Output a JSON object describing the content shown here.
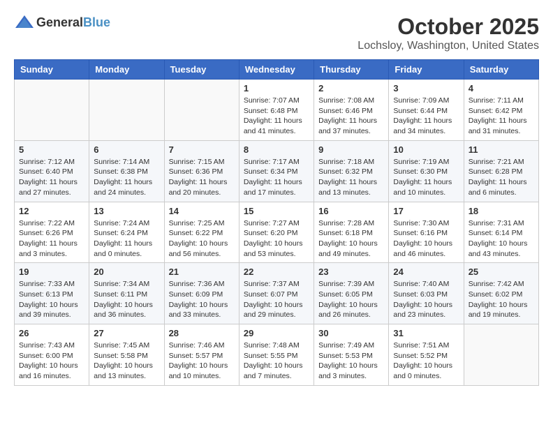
{
  "header": {
    "logo_general": "General",
    "logo_blue": "Blue",
    "month": "October 2025",
    "location": "Lochsloy, Washington, United States"
  },
  "weekdays": [
    "Sunday",
    "Monday",
    "Tuesday",
    "Wednesday",
    "Thursday",
    "Friday",
    "Saturday"
  ],
  "weeks": [
    [
      {
        "day": "",
        "sunrise": "",
        "sunset": "",
        "daylight": ""
      },
      {
        "day": "",
        "sunrise": "",
        "sunset": "",
        "daylight": ""
      },
      {
        "day": "",
        "sunrise": "",
        "sunset": "",
        "daylight": ""
      },
      {
        "day": "1",
        "sunrise": "Sunrise: 7:07 AM",
        "sunset": "Sunset: 6:48 PM",
        "daylight": "Daylight: 11 hours and 41 minutes."
      },
      {
        "day": "2",
        "sunrise": "Sunrise: 7:08 AM",
        "sunset": "Sunset: 6:46 PM",
        "daylight": "Daylight: 11 hours and 37 minutes."
      },
      {
        "day": "3",
        "sunrise": "Sunrise: 7:09 AM",
        "sunset": "Sunset: 6:44 PM",
        "daylight": "Daylight: 11 hours and 34 minutes."
      },
      {
        "day": "4",
        "sunrise": "Sunrise: 7:11 AM",
        "sunset": "Sunset: 6:42 PM",
        "daylight": "Daylight: 11 hours and 31 minutes."
      }
    ],
    [
      {
        "day": "5",
        "sunrise": "Sunrise: 7:12 AM",
        "sunset": "Sunset: 6:40 PM",
        "daylight": "Daylight: 11 hours and 27 minutes."
      },
      {
        "day": "6",
        "sunrise": "Sunrise: 7:14 AM",
        "sunset": "Sunset: 6:38 PM",
        "daylight": "Daylight: 11 hours and 24 minutes."
      },
      {
        "day": "7",
        "sunrise": "Sunrise: 7:15 AM",
        "sunset": "Sunset: 6:36 PM",
        "daylight": "Daylight: 11 hours and 20 minutes."
      },
      {
        "day": "8",
        "sunrise": "Sunrise: 7:17 AM",
        "sunset": "Sunset: 6:34 PM",
        "daylight": "Daylight: 11 hours and 17 minutes."
      },
      {
        "day": "9",
        "sunrise": "Sunrise: 7:18 AM",
        "sunset": "Sunset: 6:32 PM",
        "daylight": "Daylight: 11 hours and 13 minutes."
      },
      {
        "day": "10",
        "sunrise": "Sunrise: 7:19 AM",
        "sunset": "Sunset: 6:30 PM",
        "daylight": "Daylight: 11 hours and 10 minutes."
      },
      {
        "day": "11",
        "sunrise": "Sunrise: 7:21 AM",
        "sunset": "Sunset: 6:28 PM",
        "daylight": "Daylight: 11 hours and 6 minutes."
      }
    ],
    [
      {
        "day": "12",
        "sunrise": "Sunrise: 7:22 AM",
        "sunset": "Sunset: 6:26 PM",
        "daylight": "Daylight: 11 hours and 3 minutes."
      },
      {
        "day": "13",
        "sunrise": "Sunrise: 7:24 AM",
        "sunset": "Sunset: 6:24 PM",
        "daylight": "Daylight: 11 hours and 0 minutes."
      },
      {
        "day": "14",
        "sunrise": "Sunrise: 7:25 AM",
        "sunset": "Sunset: 6:22 PM",
        "daylight": "Daylight: 10 hours and 56 minutes."
      },
      {
        "day": "15",
        "sunrise": "Sunrise: 7:27 AM",
        "sunset": "Sunset: 6:20 PM",
        "daylight": "Daylight: 10 hours and 53 minutes."
      },
      {
        "day": "16",
        "sunrise": "Sunrise: 7:28 AM",
        "sunset": "Sunset: 6:18 PM",
        "daylight": "Daylight: 10 hours and 49 minutes."
      },
      {
        "day": "17",
        "sunrise": "Sunrise: 7:30 AM",
        "sunset": "Sunset: 6:16 PM",
        "daylight": "Daylight: 10 hours and 46 minutes."
      },
      {
        "day": "18",
        "sunrise": "Sunrise: 7:31 AM",
        "sunset": "Sunset: 6:14 PM",
        "daylight": "Daylight: 10 hours and 43 minutes."
      }
    ],
    [
      {
        "day": "19",
        "sunrise": "Sunrise: 7:33 AM",
        "sunset": "Sunset: 6:13 PM",
        "daylight": "Daylight: 10 hours and 39 minutes."
      },
      {
        "day": "20",
        "sunrise": "Sunrise: 7:34 AM",
        "sunset": "Sunset: 6:11 PM",
        "daylight": "Daylight: 10 hours and 36 minutes."
      },
      {
        "day": "21",
        "sunrise": "Sunrise: 7:36 AM",
        "sunset": "Sunset: 6:09 PM",
        "daylight": "Daylight: 10 hours and 33 minutes."
      },
      {
        "day": "22",
        "sunrise": "Sunrise: 7:37 AM",
        "sunset": "Sunset: 6:07 PM",
        "daylight": "Daylight: 10 hours and 29 minutes."
      },
      {
        "day": "23",
        "sunrise": "Sunrise: 7:39 AM",
        "sunset": "Sunset: 6:05 PM",
        "daylight": "Daylight: 10 hours and 26 minutes."
      },
      {
        "day": "24",
        "sunrise": "Sunrise: 7:40 AM",
        "sunset": "Sunset: 6:03 PM",
        "daylight": "Daylight: 10 hours and 23 minutes."
      },
      {
        "day": "25",
        "sunrise": "Sunrise: 7:42 AM",
        "sunset": "Sunset: 6:02 PM",
        "daylight": "Daylight: 10 hours and 19 minutes."
      }
    ],
    [
      {
        "day": "26",
        "sunrise": "Sunrise: 7:43 AM",
        "sunset": "Sunset: 6:00 PM",
        "daylight": "Daylight: 10 hours and 16 minutes."
      },
      {
        "day": "27",
        "sunrise": "Sunrise: 7:45 AM",
        "sunset": "Sunset: 5:58 PM",
        "daylight": "Daylight: 10 hours and 13 minutes."
      },
      {
        "day": "28",
        "sunrise": "Sunrise: 7:46 AM",
        "sunset": "Sunset: 5:57 PM",
        "daylight": "Daylight: 10 hours and 10 minutes."
      },
      {
        "day": "29",
        "sunrise": "Sunrise: 7:48 AM",
        "sunset": "Sunset: 5:55 PM",
        "daylight": "Daylight: 10 hours and 7 minutes."
      },
      {
        "day": "30",
        "sunrise": "Sunrise: 7:49 AM",
        "sunset": "Sunset: 5:53 PM",
        "daylight": "Daylight: 10 hours and 3 minutes."
      },
      {
        "day": "31",
        "sunrise": "Sunrise: 7:51 AM",
        "sunset": "Sunset: 5:52 PM",
        "daylight": "Daylight: 10 hours and 0 minutes."
      },
      {
        "day": "",
        "sunrise": "",
        "sunset": "",
        "daylight": ""
      }
    ]
  ]
}
